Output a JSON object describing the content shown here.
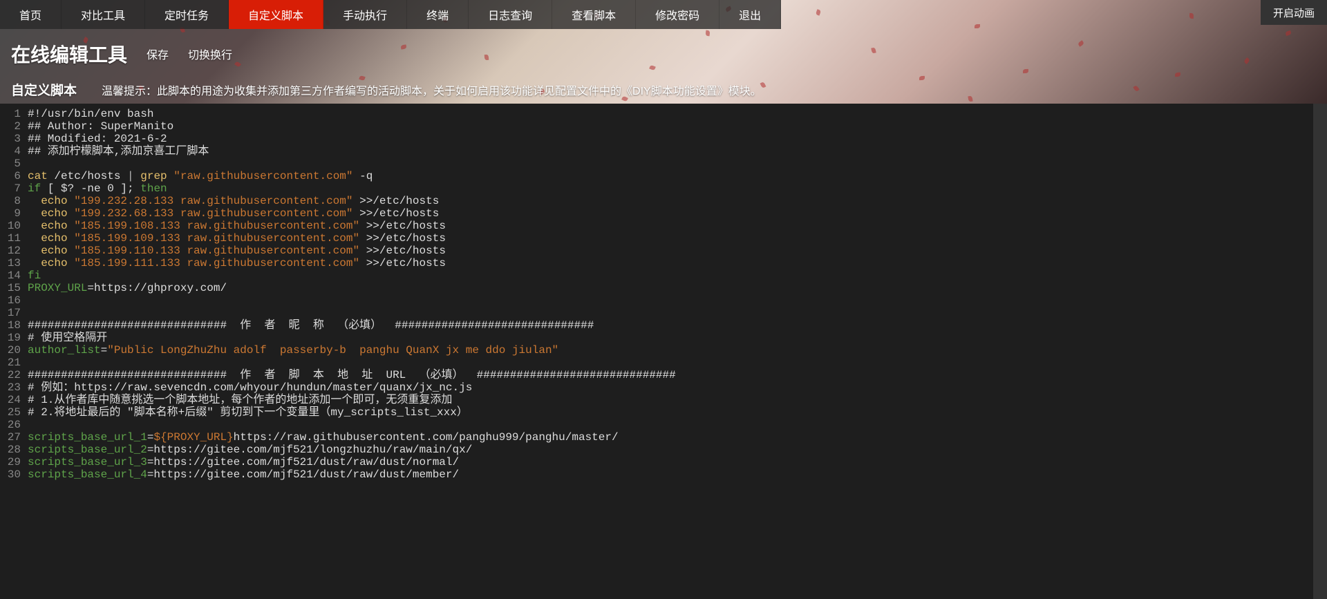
{
  "nav": {
    "items": [
      "首页",
      "对比工具",
      "定时任务",
      "自定义脚本",
      "手动执行",
      "终端",
      "日志查询",
      "查看脚本",
      "修改密码",
      "退出"
    ],
    "activeIndex": 3,
    "rightButton": "开启动画"
  },
  "header": {
    "title": "在线编辑工具",
    "buttons": [
      "保存",
      "切换换行"
    ],
    "subTitle": "自定义脚本",
    "tipLabel": "温馨提示：",
    "tipText": "此脚本的用途为收集并添加第三方作者编写的活动脚本，关于如何启用该功能详见配置文件中的《DIY脚本功能设置》模块。"
  },
  "editor": {
    "lines": [
      {
        "n": 1,
        "t": [
          [
            "plain",
            "#!/usr/bin/env bash"
          ]
        ]
      },
      {
        "n": 2,
        "t": [
          [
            "plain",
            "## Author: SuperManito"
          ]
        ]
      },
      {
        "n": 3,
        "t": [
          [
            "plain",
            "## Modified: 2021-6-2"
          ]
        ]
      },
      {
        "n": 4,
        "t": [
          [
            "plain",
            "## 添加柠檬脚本,添加京喜工厂脚本"
          ]
        ]
      },
      {
        "n": 5,
        "t": []
      },
      {
        "n": 6,
        "t": [
          [
            "cmd",
            "cat"
          ],
          [
            "plain",
            " /etc/hosts "
          ],
          [
            "punct",
            "|"
          ],
          [
            "plain",
            " "
          ],
          [
            "cmd",
            "grep"
          ],
          [
            "plain",
            " "
          ],
          [
            "str",
            "\"raw.githubusercontent.com\""
          ],
          [
            "plain",
            " -q"
          ]
        ]
      },
      {
        "n": 7,
        "t": [
          [
            "kw",
            "if"
          ],
          [
            "plain",
            " [ "
          ],
          [
            "plain",
            "$? -ne 0"
          ],
          [
            "plain",
            " ]; "
          ],
          [
            "kw",
            "then"
          ]
        ]
      },
      {
        "n": 8,
        "t": [
          [
            "plain",
            "  "
          ],
          [
            "cmd",
            "echo"
          ],
          [
            "plain",
            " "
          ],
          [
            "str",
            "\"199.232.28.133 raw.githubusercontent.com\""
          ],
          [
            "plain",
            " >>/etc/hosts"
          ]
        ]
      },
      {
        "n": 9,
        "t": [
          [
            "plain",
            "  "
          ],
          [
            "cmd",
            "echo"
          ],
          [
            "plain",
            " "
          ],
          [
            "str",
            "\"199.232.68.133 raw.githubusercontent.com\""
          ],
          [
            "plain",
            " >>/etc/hosts"
          ]
        ]
      },
      {
        "n": 10,
        "t": [
          [
            "plain",
            "  "
          ],
          [
            "cmd",
            "echo"
          ],
          [
            "plain",
            " "
          ],
          [
            "str",
            "\"185.199.108.133 raw.githubusercontent.com\""
          ],
          [
            "plain",
            " >>/etc/hosts"
          ]
        ]
      },
      {
        "n": 11,
        "t": [
          [
            "plain",
            "  "
          ],
          [
            "cmd",
            "echo"
          ],
          [
            "plain",
            " "
          ],
          [
            "str",
            "\"185.199.109.133 raw.githubusercontent.com\""
          ],
          [
            "plain",
            " >>/etc/hosts"
          ]
        ]
      },
      {
        "n": 12,
        "t": [
          [
            "plain",
            "  "
          ],
          [
            "cmd",
            "echo"
          ],
          [
            "plain",
            " "
          ],
          [
            "str",
            "\"185.199.110.133 raw.githubusercontent.com\""
          ],
          [
            "plain",
            " >>/etc/hosts"
          ]
        ]
      },
      {
        "n": 13,
        "t": [
          [
            "plain",
            "  "
          ],
          [
            "cmd",
            "echo"
          ],
          [
            "plain",
            " "
          ],
          [
            "str",
            "\"185.199.111.133 raw.githubusercontent.com\""
          ],
          [
            "plain",
            " >>/etc/hosts"
          ]
        ]
      },
      {
        "n": 14,
        "t": [
          [
            "kw",
            "fi"
          ]
        ]
      },
      {
        "n": 15,
        "t": [
          [
            "var",
            "PROXY_URL"
          ],
          [
            "plain",
            "=https://ghproxy.com/"
          ]
        ]
      },
      {
        "n": 16,
        "t": []
      },
      {
        "n": 17,
        "t": []
      },
      {
        "n": 18,
        "t": [
          [
            "plain",
            "##############################  作  者  昵  称  （必填）  ##############################"
          ]
        ]
      },
      {
        "n": 19,
        "t": [
          [
            "plain",
            "# 使用空格隔开"
          ]
        ]
      },
      {
        "n": 20,
        "t": [
          [
            "var",
            "author_list"
          ],
          [
            "plain",
            "="
          ],
          [
            "str",
            "\"Public LongZhuZhu adolf  passerby-b  panghu QuanX jx me ddo jiulan\""
          ]
        ]
      },
      {
        "n": 21,
        "t": []
      },
      {
        "n": 22,
        "t": [
          [
            "plain",
            "##############################  作  者  脚  本  地  址  URL  （必填）  ##############################"
          ]
        ]
      },
      {
        "n": 23,
        "t": [
          [
            "plain",
            "# 例如：https://raw.sevencdn.com/whyour/hundun/master/quanx/jx_nc.js"
          ]
        ]
      },
      {
        "n": 24,
        "t": [
          [
            "plain",
            "# 1.从作者库中随意挑选一个脚本地址，每个作者的地址添加一个即可，无须重复添加"
          ]
        ]
      },
      {
        "n": 25,
        "t": [
          [
            "plain",
            "# 2.将地址最后的 \"脚本名称+后缀\" 剪切到下一个变量里（my_scripts_list_xxx）"
          ]
        ]
      },
      {
        "n": 26,
        "t": []
      },
      {
        "n": 27,
        "t": [
          [
            "var",
            "scripts_base_url_1"
          ],
          [
            "plain",
            "="
          ],
          [
            "subst",
            "${PROXY_URL}"
          ],
          [
            "plain",
            "https://raw.githubusercontent.com/panghu999/panghu/master/"
          ]
        ]
      },
      {
        "n": 28,
        "t": [
          [
            "var",
            "scripts_base_url_2"
          ],
          [
            "plain",
            "=https://gitee.com/mjf521/longzhuzhu/raw/main/qx/"
          ]
        ]
      },
      {
        "n": 29,
        "t": [
          [
            "var",
            "scripts_base_url_3"
          ],
          [
            "plain",
            "=https://gitee.com/mjf521/dust/raw/dust/normal/"
          ]
        ]
      },
      {
        "n": 30,
        "t": [
          [
            "var",
            "scripts_base_url_4"
          ],
          [
            "plain",
            "=https://gitee.com/mjf521/dust/raw/dust/member/"
          ]
        ]
      }
    ]
  }
}
